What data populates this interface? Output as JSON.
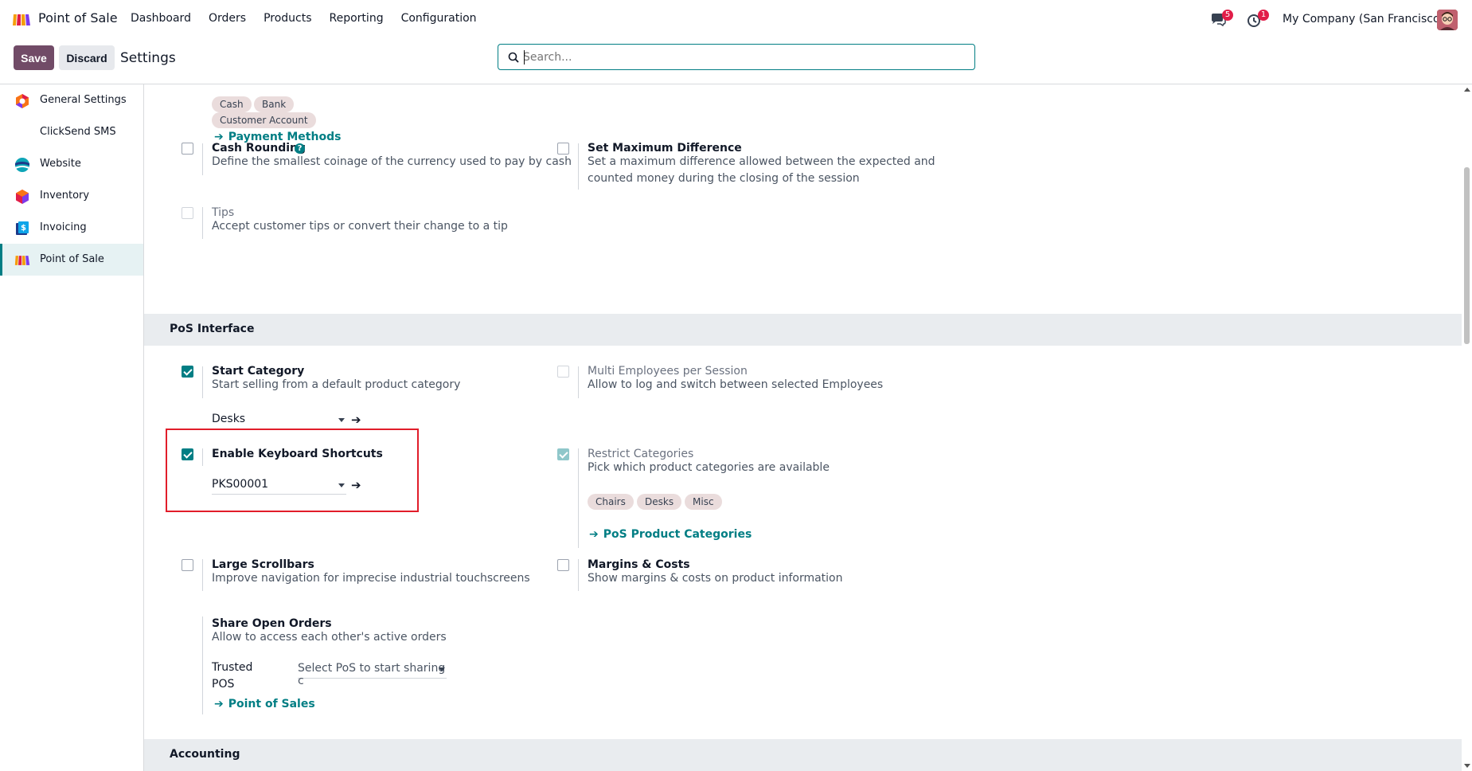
{
  "topbar": {
    "app_name": "Point of Sale",
    "menu": [
      "Dashboard",
      "Orders",
      "Products",
      "Reporting",
      "Configuration"
    ],
    "chat_count": "5",
    "activity_count": "1",
    "company": "My Company (San Francisco)"
  },
  "controlbar": {
    "save_label": "Save",
    "discard_label": "Discard",
    "title": "Settings",
    "search_placeholder": "Search..."
  },
  "sidebar": {
    "items": [
      {
        "label": "General Settings",
        "icon": "odoo-settings-icon"
      },
      {
        "label": "ClickSend SMS",
        "icon": ""
      },
      {
        "label": "Website",
        "icon": "website-icon"
      },
      {
        "label": "Inventory",
        "icon": "inventory-icon"
      },
      {
        "label": "Invoicing",
        "icon": "invoicing-icon"
      },
      {
        "label": "Point of Sale",
        "icon": "point-of-sale-icon",
        "active": true
      }
    ]
  },
  "payment": {
    "tags": [
      "Cash",
      "Bank",
      "Customer Account"
    ],
    "link": "Payment Methods"
  },
  "settings": {
    "cash_rounding": {
      "title": "Cash Rounding",
      "desc": "Define the smallest coinage of the currency used to pay by cash",
      "checked": false
    },
    "max_difference": {
      "title": "Set Maximum Difference",
      "desc1": "Set a maximum difference allowed between the expected and",
      "desc2": "counted money during the closing of the session",
      "checked": false
    },
    "tips": {
      "title": "Tips",
      "desc": "Accept customer tips or convert their change to a tip",
      "checked": false
    }
  },
  "pos_interface": {
    "heading": "PoS Interface",
    "start_category": {
      "title": "Start Category",
      "desc": "Start selling from a default product category",
      "value": "Desks",
      "checked": true
    },
    "multi_employees": {
      "title": "Multi Employees per Session",
      "desc": "Allow to log and switch between selected Employees",
      "checked": false
    },
    "keyboard_shortcuts": {
      "title": "Enable Keyboard Shortcuts",
      "value": "PKS00001",
      "checked": true
    },
    "restrict_categories": {
      "title": "Restrict Categories",
      "desc": "Pick which product categories are available",
      "tags": [
        "Chairs",
        "Desks",
        "Misc"
      ],
      "link": "PoS Product Categories",
      "checked": true
    },
    "large_scrollbars": {
      "title": "Large Scrollbars",
      "desc": "Improve navigation for imprecise industrial touchscreens",
      "checked": false
    },
    "margins_costs": {
      "title": "Margins & Costs",
      "desc": "Show margins & costs on product information",
      "checked": false
    },
    "share_orders": {
      "title": "Share Open Orders",
      "desc": "Allow to access each other's active orders",
      "trusted_label_1": "Trusted",
      "trusted_label_2": "POS",
      "trusted_placeholder": "Select PoS to start sharing c",
      "link": "Point of Sales"
    }
  },
  "accounting": {
    "heading": "Accounting"
  },
  "colors": {
    "accent": "#017e84",
    "brand": "#714b67",
    "highlight": "#e11d2a"
  }
}
